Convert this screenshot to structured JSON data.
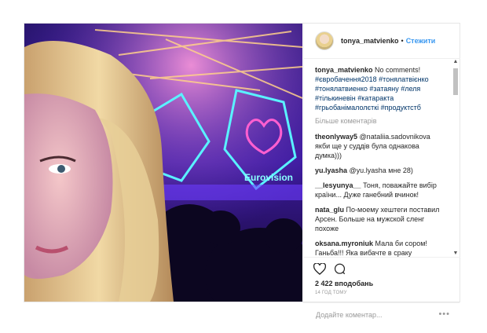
{
  "header": {
    "username": "tonya_matvienko",
    "separator": "•",
    "follow_label": "Стежити"
  },
  "caption": {
    "user": "tonya_matvienko",
    "text": "No comments!",
    "tags": "#євробачення2018 #тонялатвієнко #тонялатвиенко #затаяну #леля #тількиневін #катаракта #грьобанімалолєткі #продуктстб"
  },
  "more_comments": "Більше коментарів",
  "comments": [
    {
      "user": "theonlyway5",
      "text": "@nataliia.sadovnikova якби ще у суддів була однакова думка)))"
    },
    {
      "user": "yu.lyasha",
      "text": "@yu.lyasha мне 28)"
    },
    {
      "user": "__lesyunya__",
      "text": "Тоня, поважайте вибір країни... Дуже ганебний вчинок!"
    },
    {
      "user": "nata_glu",
      "text": "По-моему хештеги поставил Арсен. Больше на мужской сленг похоже"
    },
    {
      "user": "oksana.myroniuk",
      "text": "Мала би сором! Ганьба!!! Яка вибачте в сраку катаракта? Чи підлітки не люди і не мають права голосувати?! Якраз вони найбільше наближені до Європи і вони знають що"
    }
  ],
  "actions": {
    "likes": "2 422 вподобань",
    "time": "14 год тому"
  },
  "add_comment": {
    "placeholder": "Додайте коментар..."
  },
  "menu_label": "•••",
  "scrollbar": {
    "up": "▲",
    "down": "▼"
  },
  "photo": {
    "logo_text": "Eurovision"
  },
  "icons": [
    "heart-icon",
    "comment-icon",
    "more-options-icon"
  ]
}
